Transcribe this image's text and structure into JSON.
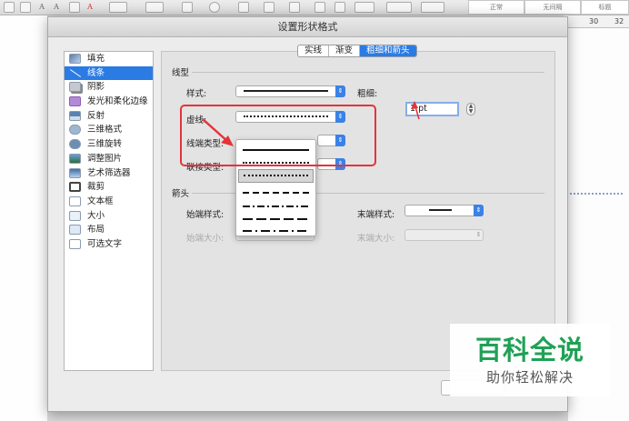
{
  "app": {
    "toolbar_style_labels": [
      "正常",
      "无间隔",
      "标题"
    ],
    "ruler_marks": [
      "30",
      "32"
    ]
  },
  "dialog": {
    "title": "设置形状格式",
    "sidebar": {
      "items": [
        {
          "label": "填充",
          "icon": "fill-bucket-icon",
          "selected": false
        },
        {
          "label": "线条",
          "icon": "line-icon",
          "selected": true
        },
        {
          "label": "阴影",
          "icon": "shadow-icon",
          "selected": false
        },
        {
          "label": "发光和柔化边缘",
          "icon": "glow-icon",
          "selected": false
        },
        {
          "label": "反射",
          "icon": "reflection-icon",
          "selected": false
        },
        {
          "label": "三维格式",
          "icon": "3d-format-icon",
          "selected": false
        },
        {
          "label": "三维旋转",
          "icon": "3d-rotation-icon",
          "selected": false
        },
        {
          "label": "调整图片",
          "icon": "adjust-picture-icon",
          "selected": false
        },
        {
          "label": "艺术筛选器",
          "icon": "artistic-filter-icon",
          "selected": false
        },
        {
          "label": "裁剪",
          "icon": "crop-icon",
          "selected": false
        },
        {
          "label": "文本框",
          "icon": "textbox-icon",
          "selected": false
        },
        {
          "label": "大小",
          "icon": "size-icon",
          "selected": false
        },
        {
          "label": "布局",
          "icon": "layout-icon",
          "selected": false
        },
        {
          "label": "可选文字",
          "icon": "alt-text-icon",
          "selected": false
        }
      ]
    },
    "tabs": [
      {
        "label": "实线",
        "active": false
      },
      {
        "label": "渐变",
        "active": false
      },
      {
        "label": "粗细和箭头",
        "active": true
      }
    ],
    "line_group": {
      "heading": "线型",
      "style_label": "样式:",
      "weight_label": "粗细:",
      "weight_value": "1 pt",
      "dash_label": "虚线:",
      "cap_label": "线端类型:",
      "join_label": "联接类型:"
    },
    "dash_options": [
      "solid",
      "round-dot",
      "square-dot",
      "dash",
      "dash-dot",
      "long-dash",
      "long-dash-dot"
    ],
    "dash_selected_index": 2,
    "arrow_group": {
      "heading": "箭头",
      "begin_style_label": "始端样式:",
      "end_style_label": "末端样式:",
      "begin_size_label": "始端大小:",
      "end_size_label": "末端大小:"
    },
    "colors": {
      "accent": "#2b7be4",
      "annotation": "#e3343a"
    }
  },
  "watermark": {
    "title": "百科全说",
    "subtitle": "助你轻松解决"
  }
}
